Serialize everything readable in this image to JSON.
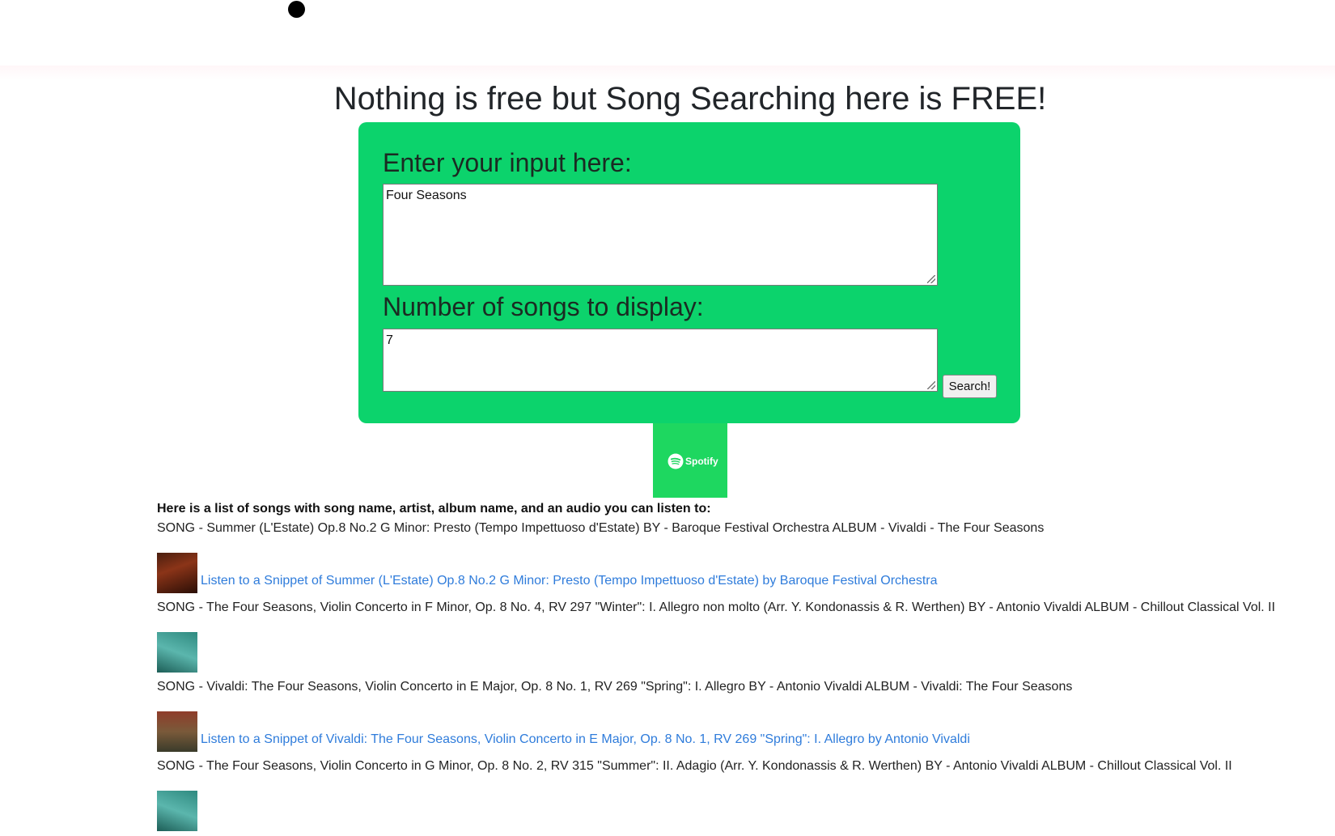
{
  "page": {
    "title": "Nothing is free but Song Searching here is FREE!"
  },
  "form": {
    "input_label": "Enter your input here:",
    "input_value": "Four Seasons",
    "count_label": "Number of songs to display:",
    "count_value": "7",
    "search_label": "Search!"
  },
  "logo": {
    "text": "Spotify",
    "color": "#1ed760",
    "icon": "spotify-icon"
  },
  "colors": {
    "card": "#0cd36c",
    "link": "#2f7cdb"
  },
  "results": {
    "heading": "Here is a list of songs with song name, artist, album name, and an audio you can listen to:",
    "songs": [
      {
        "text": "SONG - Summer (L'Estate) Op.8 No.2 G Minor: Presto (Tempo Impettuoso d'Estate) BY - Baroque Festival Orchestra ALBUM - Vivaldi - The Four Seasons",
        "link": "Listen to a Snippet of Summer (L'Estate) Op.8 No.2 G Minor: Presto (Tempo Impettuoso d'Estate) by Baroque Festival Orchestra"
      },
      {
        "text": "SONG - The Four Seasons, Violin Concerto in F Minor, Op. 8 No. 4, RV 297 \"Winter\": I. Allegro non molto (Arr. Y. Kondonassis & R. Werthen) BY - Antonio Vivaldi ALBUM - Chillout Classical Vol. II",
        "link": ""
      },
      {
        "text": "SONG - Vivaldi: The Four Seasons, Violin Concerto in E Major, Op. 8 No. 1, RV 269 \"Spring\": I. Allegro BY - Antonio Vivaldi ALBUM - Vivaldi: The Four Seasons",
        "link": "Listen to a Snippet of Vivaldi: The Four Seasons, Violin Concerto in E Major, Op. 8 No. 1, RV 269 \"Spring\": I. Allegro by Antonio Vivaldi"
      },
      {
        "text": "SONG - The Four Seasons, Violin Concerto in G Minor, Op. 8 No. 2, RV 315 \"Summer\": II. Adagio (Arr. Y. Kondonassis & R. Werthen) BY - Antonio Vivaldi ALBUM - Chillout Classical Vol. II",
        "link": ""
      }
    ]
  }
}
